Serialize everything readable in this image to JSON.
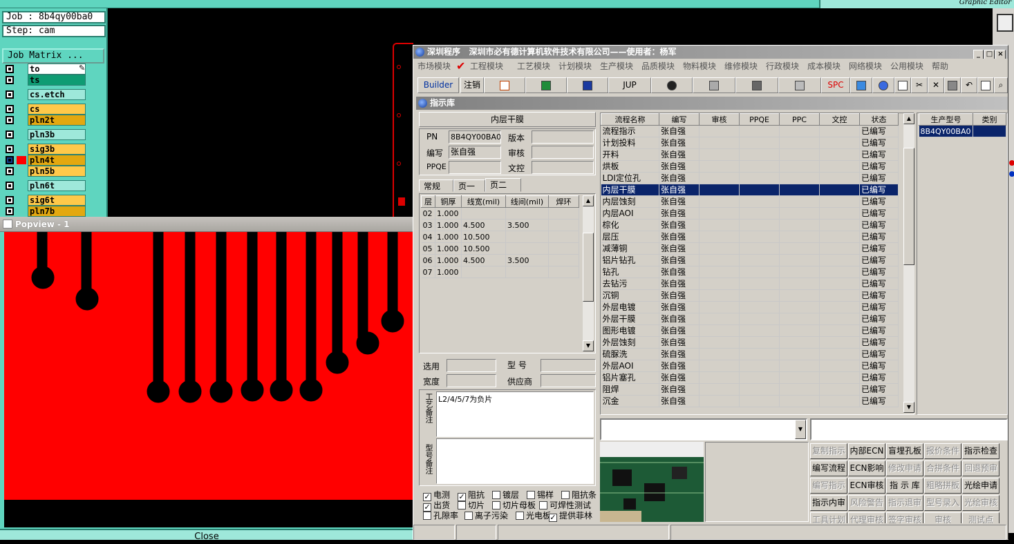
{
  "cam": {
    "top_right_text": "Graphic Editor",
    "job_label": "Job : 8b4qy00ba0",
    "step_label": "Step: cam",
    "job_matrix_button": "Job Matrix ...",
    "layers": [
      {
        "name": "to",
        "color": "#ffffff",
        "checked": false,
        "extra": "pencil"
      },
      {
        "name": "ts",
        "color": "#0f9c73",
        "checked": false
      },
      {
        "name": "cs.etch",
        "color": "#9ee8da",
        "checked": false
      },
      {
        "name": "cs",
        "color": "#ffc94a",
        "checked": false
      },
      {
        "name": "pln2t",
        "color": "#e3a810",
        "checked": false
      },
      {
        "name": "pln3b",
        "color": "#9ee8da",
        "checked": false
      },
      {
        "name": "sig3b",
        "color": "#ffc94a",
        "checked": false
      },
      {
        "name": "pln4t",
        "color": "#e3a810",
        "checked": true
      },
      {
        "name": "pln5b",
        "color": "#ffc94a",
        "checked": false
      },
      {
        "name": "pln6t",
        "color": "#9ee8da",
        "checked": false
      },
      {
        "name": "sig6t",
        "color": "#ffc94a",
        "checked": false
      },
      {
        "name": "pln7b",
        "color": "#e3a810",
        "checked": false
      }
    ],
    "popview_title": "Popview - 1",
    "close_label": "Close",
    "colors": {
      "board": "#ff0000",
      "background": "#000000",
      "panel": "#5fd5bf"
    }
  },
  "erp": {
    "title": "深圳程序   深圳市必有德计算机软件技术有限公司——使用者：杨军",
    "menu": [
      "市场模块",
      "工程模块",
      "工艺模块",
      "计划模块",
      "生产模块",
      "品质模块",
      "物料模块",
      "维修模块",
      "行政模块",
      "成本模块",
      "网络模块",
      "公用模块",
      "帮助"
    ],
    "toolbar": {
      "builder": "Builder",
      "logout": "注销",
      "jup": "JUP",
      "spc": "SPC"
    },
    "sub_title": "指示库",
    "form": {
      "section_title": "内层干膜",
      "pn_label": "PN",
      "pn_value": "8B4QY00BA0",
      "version_label": "版本",
      "version_value": "",
      "author_label": "编写",
      "author_value": "张自强",
      "review_label": "审核",
      "review_value": "",
      "ppqe_label": "PPQE",
      "ppqe_value": "",
      "doc_label": "文控",
      "doc_value": ""
    },
    "tabs": [
      "常规",
      "页一",
      "页二"
    ],
    "layer_table": {
      "headers": [
        "层",
        "铜厚",
        "线宽(mil)",
        "线间(mil)",
        "焊环"
      ],
      "rows": [
        [
          "02",
          "1.000",
          "",
          "",
          ""
        ],
        [
          "03",
          "1.000",
          "4.500",
          "3.500",
          ""
        ],
        [
          "04",
          "1.000",
          "10.500",
          "",
          ""
        ],
        [
          "05",
          "1.000",
          "10.500",
          "",
          ""
        ],
        [
          "06",
          "1.000",
          "4.500",
          "3.500",
          ""
        ],
        [
          "07",
          "1.000",
          "",
          "",
          ""
        ]
      ]
    },
    "select_label": "选用",
    "width_label": "宽度",
    "model_label": "型 号",
    "supplier_label": "供应商",
    "process_note_label": "工艺备注",
    "process_note_text": "L2/4/5/7为负片",
    "model_note_label": "型号备注",
    "checkboxes": [
      {
        "label": "电测",
        "checked": true
      },
      {
        "label": "阻抗",
        "checked": true
      },
      {
        "label": "镀层",
        "checked": false
      },
      {
        "label": "锡样",
        "checked": false
      },
      {
        "label": "阻抗条",
        "checked": false
      },
      {
        "label": "出货",
        "checked": true
      },
      {
        "label": "切片",
        "checked": false
      },
      {
        "label": "切片母板",
        "checked": false
      },
      {
        "label": "可焊性测试",
        "checked": false
      },
      {
        "label": "孔隙率",
        "checked": false
      },
      {
        "label": "离子污染",
        "checked": false
      },
      {
        "label": "光电板",
        "checked": false
      },
      {
        "label": "提供菲林",
        "checked": true
      }
    ],
    "process_table": {
      "headers": [
        "流程名称",
        "编写",
        "审核",
        "PPQE",
        "PPC",
        "文控",
        "状态"
      ],
      "selected_index": 5,
      "rows": [
        [
          "流程指示",
          "张自强",
          "",
          "",
          "",
          "",
          "已编写"
        ],
        [
          "计划投料",
          "张自强",
          "",
          "",
          "",
          "",
          "已编写"
        ],
        [
          "开料",
          "张自强",
          "",
          "",
          "",
          "",
          "已编写"
        ],
        [
          "烘板",
          "张自强",
          "",
          "",
          "",
          "",
          "已编写"
        ],
        [
          "LDI定位孔",
          "张自强",
          "",
          "",
          "",
          "",
          "已编写"
        ],
        [
          "内层干膜",
          "张自强",
          "",
          "",
          "",
          "",
          "已编写"
        ],
        [
          "内层蚀刻",
          "张自强",
          "",
          "",
          "",
          "",
          "已编写"
        ],
        [
          "内层AOI",
          "张自强",
          "",
          "",
          "",
          "",
          "已编写"
        ],
        [
          "棕化",
          "张自强",
          "",
          "",
          "",
          "",
          "已编写"
        ],
        [
          "层压",
          "张自强",
          "",
          "",
          "",
          "",
          "已编写"
        ],
        [
          "减薄铜",
          "张自强",
          "",
          "",
          "",
          "",
          "已编写"
        ],
        [
          "铝片钻孔",
          "张自强",
          "",
          "",
          "",
          "",
          "已编写"
        ],
        [
          "钻孔",
          "张自强",
          "",
          "",
          "",
          "",
          "已编写"
        ],
        [
          "去钻污",
          "张自强",
          "",
          "",
          "",
          "",
          "已编写"
        ],
        [
          "沉铜",
          "张自强",
          "",
          "",
          "",
          "",
          "已编写"
        ],
        [
          "外层电镀",
          "张自强",
          "",
          "",
          "",
          "",
          "已编写"
        ],
        [
          "外层干膜",
          "张自强",
          "",
          "",
          "",
          "",
          "已编写"
        ],
        [
          "图形电镀",
          "张自强",
          "",
          "",
          "",
          "",
          "已编写"
        ],
        [
          "外层蚀刻",
          "张自强",
          "",
          "",
          "",
          "",
          "已编写"
        ],
        [
          "硫脲洗",
          "张自强",
          "",
          "",
          "",
          "",
          "已编写"
        ],
        [
          "外层AOI",
          "张自强",
          "",
          "",
          "",
          "",
          "已编写"
        ],
        [
          "铝片塞孔",
          "张自强",
          "",
          "",
          "",
          "",
          "已编写"
        ],
        [
          "阻焊",
          "张自强",
          "",
          "",
          "",
          "",
          "已编写"
        ],
        [
          "沉金",
          "张自强",
          "",
          "",
          "",
          "",
          "已编写"
        ]
      ]
    },
    "product_table": {
      "headers": [
        "生产型号",
        "类别"
      ],
      "rows": [
        [
          "8B4QY00BA0",
          ""
        ]
      ]
    },
    "func_buttons": [
      {
        "label": "复制指示",
        "enabled": false
      },
      {
        "label": "内部ECN",
        "enabled": true
      },
      {
        "label": "盲埋孔板",
        "enabled": true
      },
      {
        "label": "报价条件",
        "enabled": false
      },
      {
        "label": "指示检查",
        "enabled": true
      },
      {
        "label": "编写流程",
        "enabled": true
      },
      {
        "label": "ECN影响",
        "enabled": true
      },
      {
        "label": "修改申请",
        "enabled": false
      },
      {
        "label": "合拼条件",
        "enabled": false
      },
      {
        "label": "回退预审",
        "enabled": false
      },
      {
        "label": "编写指示",
        "enabled": false
      },
      {
        "label": "ECN审核",
        "enabled": true
      },
      {
        "label": "指 示 库",
        "enabled": true
      },
      {
        "label": "粗略拼板",
        "enabled": false
      },
      {
        "label": "光绘申请",
        "enabled": true
      },
      {
        "label": "指示内审",
        "enabled": true
      },
      {
        "label": "风险警告",
        "enabled": false
      },
      {
        "label": "指示退审",
        "enabled": false
      },
      {
        "label": "型号录入",
        "enabled": false
      },
      {
        "label": "光绘审核",
        "enabled": false
      },
      {
        "label": "工具计划",
        "enabled": false
      },
      {
        "label": "代理审核",
        "enabled": false
      },
      {
        "label": "签字审核",
        "enabled": false
      },
      {
        "label": "审核",
        "enabled": false
      },
      {
        "label": "测试点",
        "enabled": false
      }
    ],
    "colors": {
      "window": "#d4d0c8",
      "selection": "#0a246a",
      "title_gradient_start": "#808080"
    }
  }
}
